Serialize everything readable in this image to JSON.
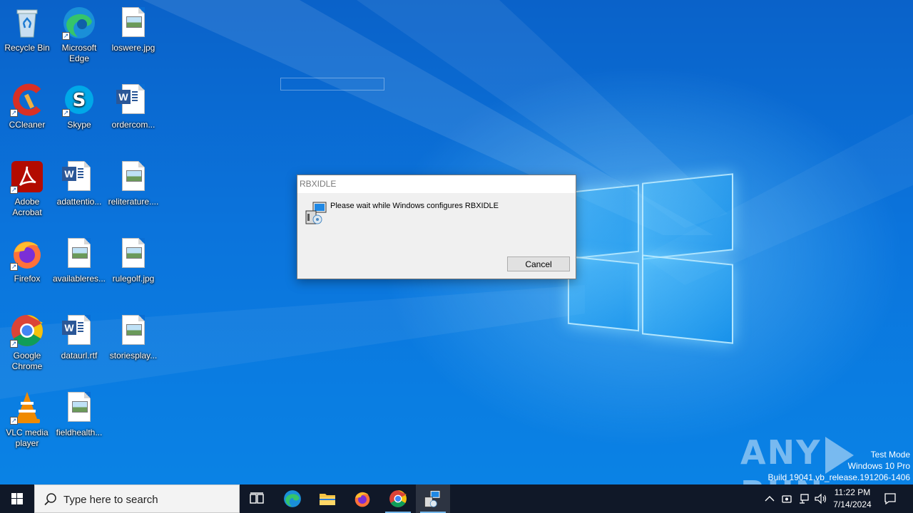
{
  "desktop": {
    "icons": [
      {
        "label": "Recycle Bin",
        "icon": "recycle-bin-icon"
      },
      {
        "label": "Microsoft Edge",
        "icon": "edge-icon"
      },
      {
        "label": "loswere.jpg",
        "icon": "image-file-icon"
      },
      {
        "label": "CCleaner",
        "icon": "ccleaner-icon"
      },
      {
        "label": "Skype",
        "icon": "skype-icon"
      },
      {
        "label": "ordercom...",
        "icon": "word-document-icon"
      },
      {
        "label": "Adobe Acrobat",
        "icon": "acrobat-icon"
      },
      {
        "label": "adattentio...",
        "icon": "word-document-icon"
      },
      {
        "label": "reliterature....",
        "icon": "image-file-icon"
      },
      {
        "label": "Firefox",
        "icon": "firefox-icon"
      },
      {
        "label": "availableres...",
        "icon": "image-file-icon"
      },
      {
        "label": "rulegolf.jpg",
        "icon": "image-file-icon"
      },
      {
        "label": "Google Chrome",
        "icon": "chrome-icon"
      },
      {
        "label": "dataurl.rtf",
        "icon": "word-document-icon"
      },
      {
        "label": "storiesplay...",
        "icon": "image-file-icon"
      },
      {
        "label": "VLC media player",
        "icon": "vlc-icon"
      },
      {
        "label": "fieldhealth...",
        "icon": "image-file-icon"
      }
    ]
  },
  "dialog": {
    "title": "RBXIDLE",
    "message": "Please wait while Windows configures RBXIDLE",
    "cancel_label": "Cancel"
  },
  "watermark": {
    "line1": "Test Mode",
    "line2": "Windows 10 Pro",
    "line3": "Build 19041.vb_release.191206-1406",
    "brand_left": "ANY",
    "brand_right": "RUN"
  },
  "taskbar": {
    "search_placeholder": "Type here to search",
    "time": "11:22 PM",
    "date": "7/14/2024"
  },
  "colors": {
    "accent": "#0078d7",
    "taskbar": "#101828",
    "dialog_bg": "#f0f0f0"
  }
}
